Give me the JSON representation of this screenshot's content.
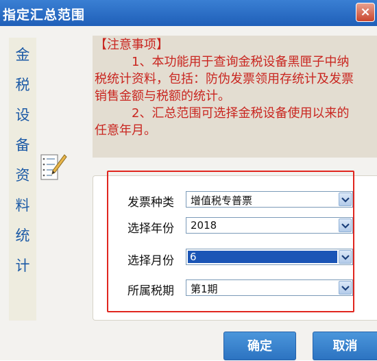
{
  "window": {
    "title": "指定汇总范围",
    "close_glyph": "×"
  },
  "side_title": [
    "金",
    "税",
    "设",
    "备",
    "资",
    "料",
    "统",
    "计"
  ],
  "notice": {
    "lines": [
      "【注意事项】",
      "　　　1、本功能用于查询金税设备黑匣子中纳",
      "税统计资料，包括：防伪发票领用存统计及发票",
      "销售金额与税额的统计。",
      "　　　2、汇总范围可选择金税设备使用以来的",
      "任意年月。"
    ]
  },
  "form": {
    "invoice_type": {
      "label": "发票种类",
      "value": "增值税专普票"
    },
    "year": {
      "label": "选择年份",
      "value": "2018"
    },
    "month": {
      "label": "选择月份",
      "value": "6"
    },
    "tax_period": {
      "label": "所属税期",
      "value": "第1期"
    }
  },
  "buttons": {
    "ok": "确定",
    "cancel": "取消"
  },
  "colors": {
    "title_bar": "#2a6fc9",
    "notice_text": "#c92620",
    "side_text": "#1c5aa6",
    "highlight_border": "#e0251e",
    "button": "#3b85d0"
  },
  "icons": {
    "notepad": "notepad-pencil-icon",
    "dropdown": "chevron-down-icon",
    "close": "close-icon"
  }
}
